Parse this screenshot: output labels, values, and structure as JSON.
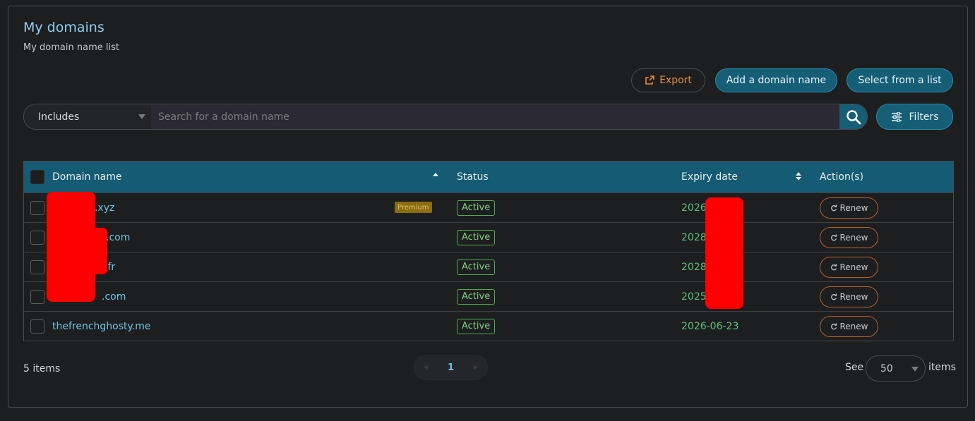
{
  "header": {
    "title": "My domains",
    "subtitle": "My domain name list"
  },
  "toolbar": {
    "export_label": "Export",
    "add_label": "Add a domain name",
    "select_label": "Select from a list",
    "filters_label": "Filters"
  },
  "search": {
    "mode": "Includes",
    "placeholder": "Search for a domain name"
  },
  "table": {
    "columns": {
      "domain": "Domain name",
      "status": "Status",
      "expiry": "Expiry date",
      "actions": "Action(s)"
    },
    "rows": [
      {
        "domain": ".xyz",
        "badge": "Premium",
        "status": "Active",
        "expiry": "2026",
        "action": "Renew"
      },
      {
        "domain": ".com",
        "badge": "",
        "status": "Active",
        "expiry": "2028",
        "action": "Renew"
      },
      {
        "domain": ".fr",
        "badge": "",
        "status": "Active",
        "expiry": "2028",
        "action": "Renew"
      },
      {
        "domain": ".com",
        "badge": "",
        "status": "Active",
        "expiry": "2025",
        "action": "Renew"
      },
      {
        "domain": "thefrenchghosty.me",
        "badge": "",
        "status": "Active",
        "expiry": "2026-06-23",
        "action": "Renew"
      }
    ]
  },
  "footer": {
    "count": "5 items",
    "current_page": "1",
    "see_label": "See",
    "per_page": "50",
    "items_label": "items"
  },
  "colors": {
    "accent": "#155e75",
    "link": "#6cc6e6",
    "status_active": "#4caf50",
    "export": "#e58a3c",
    "redaction": "#ff0000"
  }
}
